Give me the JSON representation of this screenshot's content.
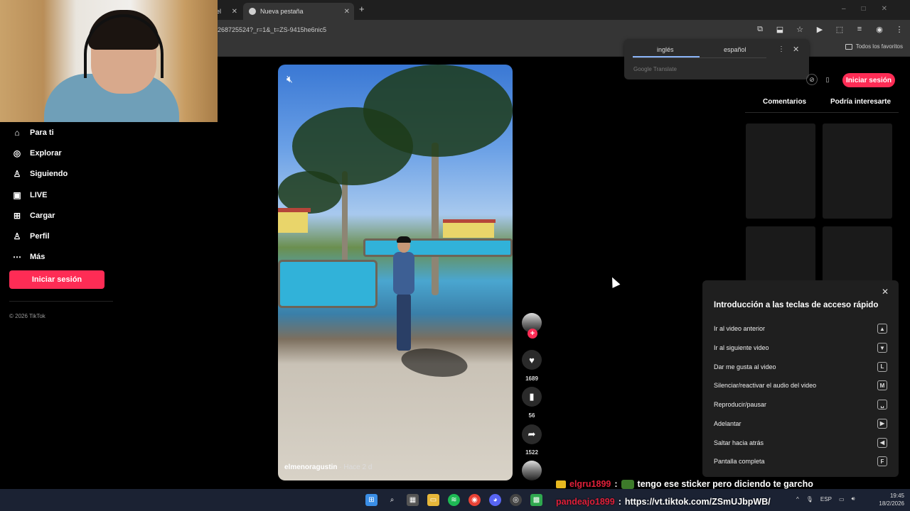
{
  "browser": {
    "tab1_label": "el",
    "tab2_label": "Nueva pestaña",
    "new_tab": "+",
    "url": "268725524?_r=1&_t=ZS-9415he6nic5",
    "favorites": "Todos los favoritos"
  },
  "translate_popup": {
    "lang_from": "inglés",
    "lang_to": "español",
    "brand": "Google Translate"
  },
  "sidebar": {
    "items": [
      {
        "label": "Para ti",
        "icon": "home-icon"
      },
      {
        "label": "Explorar",
        "icon": "compass-icon"
      },
      {
        "label": "Siguiendo",
        "icon": "following-icon"
      },
      {
        "label": "LIVE",
        "icon": "live-icon"
      },
      {
        "label": "Cargar",
        "icon": "upload-icon"
      },
      {
        "label": "Perfil",
        "icon": "profile-icon"
      },
      {
        "label": "Más",
        "icon": "more-icon"
      }
    ],
    "login_label": "Iniciar sesión",
    "copyright": "© 2026 TikTok"
  },
  "video": {
    "author": "elmenoragustin",
    "time": " · Hace 2 d",
    "likes": "1689",
    "saves": "56",
    "shares": "1522"
  },
  "header": {
    "login_label": "Iniciar sesión"
  },
  "right_panel": {
    "tabs": [
      "Comentarios",
      "Podría interesarte"
    ]
  },
  "shortcuts": {
    "title": "Introducción a las teclas de acceso rápido",
    "rows": [
      {
        "label": "Ir al video anterior",
        "key": "▲"
      },
      {
        "label": "Ir al siguiente video",
        "key": "▼"
      },
      {
        "label": "Dar me gusta al video",
        "key": "L"
      },
      {
        "label": "Silenciar/reactivar el audio del video",
        "key": "M"
      },
      {
        "label": "Reproducir/pausar",
        "key": "␣"
      },
      {
        "label": "Adelantar",
        "key": "▶"
      },
      {
        "label": "Saltar hacia atrás",
        "key": "◀"
      },
      {
        "label": "Pantalla completa",
        "key": "F"
      }
    ]
  },
  "chat": [
    {
      "user": "elgru1899",
      "sep": ":",
      "message": "tengo ese sticker pero diciendo te garcho"
    },
    {
      "user": "pandeajo1899",
      "sep": ":",
      "message": "https://vt.tiktok.com/ZSmUJbpWB/"
    }
  ],
  "taskbar": {
    "lang": "ESP",
    "time": "19:45",
    "date": "18/2/2026"
  },
  "colors": {
    "accent": "#fe2c55",
    "chat_user": "#e0203a"
  }
}
